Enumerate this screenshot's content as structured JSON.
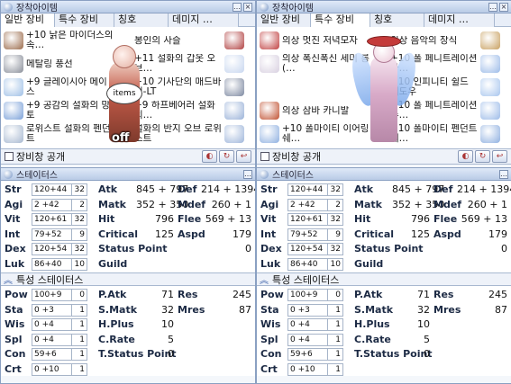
{
  "panels": [
    {
      "equip_title": "장착아이템",
      "tabs": [
        {
          "label": "일반 장비",
          "active": true
        },
        {
          "label": "특수 장비",
          "active": false
        },
        {
          "label": "칭호",
          "active": false
        },
        {
          "label": "데미지 …",
          "active": false
        }
      ],
      "left_slots": [
        {
          "name": "+10 낡은 마이더스의 속…",
          "icon": "helm-icon",
          "color": "#9a6a4a"
        },
        {
          "name": "메탈링 풍선",
          "icon": "balloon-icon",
          "color": "#8a8f9a"
        },
        {
          "name": "+9 글레이시아 메이스",
          "icon": "mace-icon",
          "color": "#9fc0e6"
        },
        {
          "name": "+9 공감의 설화의 망토",
          "icon": "garment-icon",
          "color": "#7aa0d8"
        },
        {
          "name": "로위스트 설화의 펜던트",
          "icon": "pendant-icon",
          "color": "#a7b8d0"
        }
      ],
      "right_slots": [
        {
          "name": "봉인의 사슬",
          "icon": "chain-icon",
          "color": "#b04040"
        },
        {
          "name": "+11 설화의 갑옷 오브…",
          "icon": "armor-icon",
          "color": "#c7d6ef"
        },
        {
          "name": "+10 기사단의 매드바니-LT",
          "icon": "shield-icon",
          "color": "#7c88a0"
        },
        {
          "name": "+9 하프베어러 설화의…",
          "icon": "shoes-icon",
          "color": "#9ab2d8"
        },
        {
          "name": "설화의 반지 오브 로위스트",
          "icon": "ring-icon",
          "color": "#9fb6da"
        }
      ],
      "center": {
        "sign_text": "items",
        "status_text": "off"
      },
      "bottom_label": "장비창 공개",
      "stats_title": "스테이터스",
      "stats": [
        {
          "label": "Str",
          "value": "120+44",
          "num": "32"
        },
        {
          "label": "Agi",
          "value": "2 +42",
          "num": "2"
        },
        {
          "label": "Vit",
          "value": "120+61",
          "num": "32"
        },
        {
          "label": "Int",
          "value": "79+52",
          "num": "9"
        },
        {
          "label": "Dex",
          "value": "120+54",
          "num": "32"
        },
        {
          "label": "Luk",
          "value": "86+40",
          "num": "10"
        }
      ],
      "mid_stats": [
        {
          "label": "Atk",
          "value": "845 + 797"
        },
        {
          "label": "Matk",
          "value": "352 + 350"
        },
        {
          "label": "Hit",
          "value": "796"
        },
        {
          "label": "Critical",
          "value": "125"
        },
        {
          "label": "Status Point",
          "value": ""
        },
        {
          "label": "Guild",
          "value": ""
        }
      ],
      "right_stats": [
        {
          "label": "Def",
          "value": "214 + 1394"
        },
        {
          "label": "Mdef",
          "value": "260 + 1"
        },
        {
          "label": "Flee",
          "value": "569 + 13"
        },
        {
          "label": "Aspd",
          "value": "179"
        },
        {
          "label": "",
          "value": "0"
        },
        {
          "label": "",
          "value": ""
        }
      ],
      "specials_title": "특성 스테이터스",
      "specials": [
        {
          "label": "Pow",
          "value": "100+9",
          "num": "0"
        },
        {
          "label": "Sta",
          "value": "0 +3",
          "num": "1"
        },
        {
          "label": "Wis",
          "value": "0 +4",
          "num": "1"
        },
        {
          "label": "Spl",
          "value": "0 +4",
          "num": "1"
        },
        {
          "label": "Con",
          "value": "59+6",
          "num": "1"
        },
        {
          "label": "Crt",
          "value": "0 +10",
          "num": "1"
        }
      ],
      "special_mid": [
        {
          "label": "P.Atk",
          "value": "71"
        },
        {
          "label": "S.Matk",
          "value": "32"
        },
        {
          "label": "H.Plus",
          "value": "10"
        },
        {
          "label": "C.Rate",
          "value": "5"
        },
        {
          "label": "T.Status Point",
          "value": "0"
        }
      ],
      "special_right": [
        {
          "label": "Res",
          "value": "245"
        },
        {
          "label": "Mres",
          "value": "87"
        }
      ]
    },
    {
      "equip_title": "장착아이템",
      "tabs": [
        {
          "label": "일반 장비",
          "active": false
        },
        {
          "label": "특수 장비",
          "active": true
        },
        {
          "label": "칭호",
          "active": false
        },
        {
          "label": "데미지 …",
          "active": false
        }
      ],
      "left_slots": [
        {
          "name": "의상 멋진 저녁모자",
          "icon": "hat-icon",
          "color": "#c04040"
        },
        {
          "name": "의상 폭신폭신 세미 롱(…",
          "icon": "hair-icon",
          "color": "#d8d0e0"
        },
        {
          "name": "",
          "icon": "blank-icon",
          "color": "#ffffff"
        },
        {
          "name": "의상 삼바 카니발",
          "icon": "costume-icon",
          "color": "#c05030"
        },
        {
          "name": "+10 폴마이티 이어링 쉐…",
          "icon": "earring-icon",
          "color": "#8fb0e0"
        }
      ],
      "right_slots": [
        {
          "name": "의상 음악의 장식",
          "icon": "ornament-icon",
          "color": "#c8a060"
        },
        {
          "name": "+10 폴 페니트레이션 아…",
          "icon": "shadow-armor-icon",
          "color": "#9cbbe8"
        },
        {
          "name": "+10 인피니티 쉴드 쉐도우",
          "icon": "shadow-shield-icon",
          "color": "#a8c6ee"
        },
        {
          "name": "+10 폴 페니트레이션 슈…",
          "icon": "shadow-shoes-icon",
          "color": "#9cbbe8"
        },
        {
          "name": "+10 폴마이티 펜던트 쉐…",
          "icon": "shadow-pendant-icon",
          "color": "#8fb0e0"
        }
      ],
      "center": {
        "sign_text": "",
        "status_text": ""
      },
      "bottom_label": "장비창 공개",
      "stats_title": "스테이터스",
      "stats": [
        {
          "label": "Str",
          "value": "120+44",
          "num": "32"
        },
        {
          "label": "Agi",
          "value": "2 +42",
          "num": "2"
        },
        {
          "label": "Vit",
          "value": "120+61",
          "num": "32"
        },
        {
          "label": "Int",
          "value": "79+52",
          "num": "9"
        },
        {
          "label": "Dex",
          "value": "120+54",
          "num": "32"
        },
        {
          "label": "Luk",
          "value": "86+40",
          "num": "10"
        }
      ],
      "mid_stats": [
        {
          "label": "Atk",
          "value": "845 + 797"
        },
        {
          "label": "Matk",
          "value": "352 + 350"
        },
        {
          "label": "Hit",
          "value": "796"
        },
        {
          "label": "Critical",
          "value": "125"
        },
        {
          "label": "Status Point",
          "value": ""
        },
        {
          "label": "Guild",
          "value": ""
        }
      ],
      "right_stats": [
        {
          "label": "Def",
          "value": "214 + 1394"
        },
        {
          "label": "Mdef",
          "value": "260 + 1"
        },
        {
          "label": "Flee",
          "value": "569 + 13"
        },
        {
          "label": "Aspd",
          "value": "179"
        },
        {
          "label": "",
          "value": "0"
        },
        {
          "label": "",
          "value": ""
        }
      ],
      "specials_title": "특성 스테이터스",
      "specials": [
        {
          "label": "Pow",
          "value": "100+9",
          "num": "0"
        },
        {
          "label": "Sta",
          "value": "0 +3",
          "num": "1"
        },
        {
          "label": "Wis",
          "value": "0 +4",
          "num": "1"
        },
        {
          "label": "Spl",
          "value": "0 +4",
          "num": "1"
        },
        {
          "label": "Con",
          "value": "59+6",
          "num": "1"
        },
        {
          "label": "Crt",
          "value": "0 +10",
          "num": "1"
        }
      ],
      "special_mid": [
        {
          "label": "P.Atk",
          "value": "71"
        },
        {
          "label": "S.Matk",
          "value": "32"
        },
        {
          "label": "H.Plus",
          "value": "10"
        },
        {
          "label": "C.Rate",
          "value": "5"
        },
        {
          "label": "T.Status Point",
          "value": "0"
        }
      ],
      "special_right": [
        {
          "label": "Res",
          "value": "245"
        },
        {
          "label": "Mres",
          "value": "87"
        }
      ]
    }
  ],
  "window_buttons": {
    "minimize": "…",
    "close": "×"
  },
  "mini_buttons": [
    "◐",
    "↻",
    "↩"
  ]
}
